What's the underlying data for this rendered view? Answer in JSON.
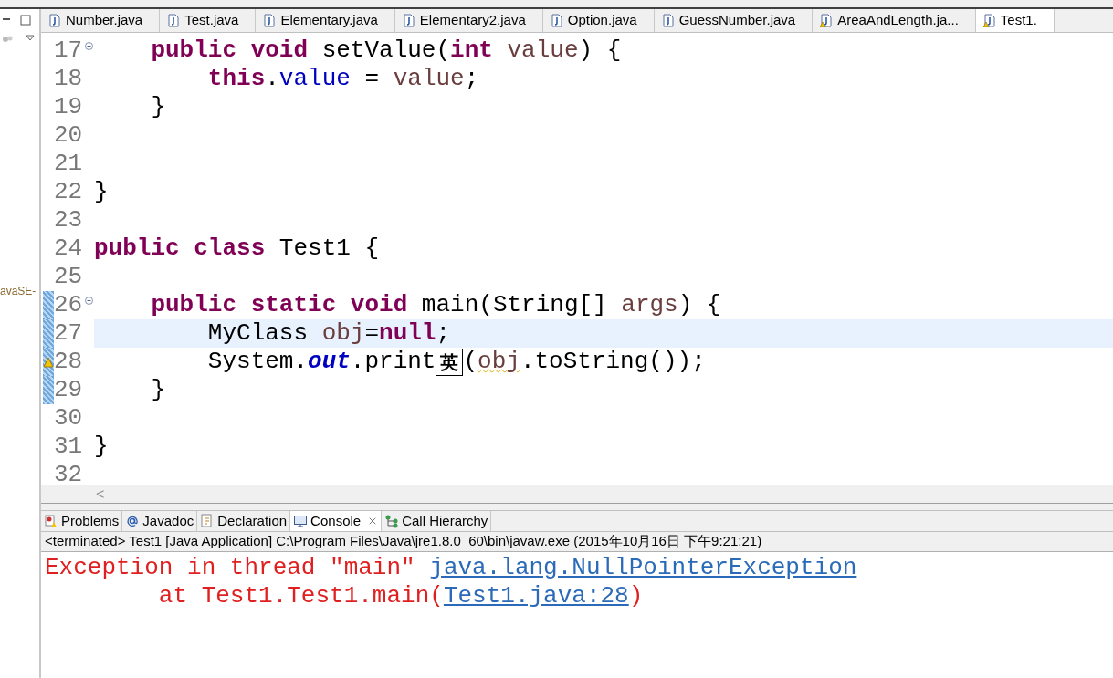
{
  "sidebar": {
    "label": "avaSE-"
  },
  "editor_tabs": [
    {
      "label": "Number.java",
      "kind": "java",
      "selected": false
    },
    {
      "label": "Test.java",
      "kind": "java",
      "selected": false
    },
    {
      "label": "Elementary.java",
      "kind": "java",
      "selected": false
    },
    {
      "label": "Elementary2.java",
      "kind": "java",
      "selected": false
    },
    {
      "label": "Option.java",
      "kind": "java",
      "selected": false
    },
    {
      "label": "GuessNumber.java",
      "kind": "java",
      "selected": false
    },
    {
      "label": "AreaAndLength.ja...",
      "kind": "java_warning",
      "selected": false
    },
    {
      "label": "Test1.",
      "kind": "java_warning",
      "selected": true
    }
  ],
  "code_lines": [
    {
      "number": "17",
      "fold": true,
      "current": false,
      "changed": false,
      "warning": false,
      "tokens": [
        {
          "text": "    public",
          "kind": "keyword"
        },
        {
          "text": " void",
          "kind": "keyword"
        },
        {
          "text": " setValue(",
          "kind": "plain"
        },
        {
          "text": "int",
          "kind": "keyword"
        },
        {
          "text": " value",
          "kind": "local"
        },
        {
          "text": ") {",
          "kind": "plain"
        }
      ]
    },
    {
      "number": "18",
      "fold": false,
      "current": false,
      "changed": false,
      "warning": false,
      "tokens": [
        {
          "text": "        this",
          "kind": "keyword"
        },
        {
          "text": ".",
          "kind": "plain"
        },
        {
          "text": "value",
          "kind": "field"
        },
        {
          "text": " = ",
          "kind": "plain"
        },
        {
          "text": "value",
          "kind": "local"
        },
        {
          "text": ";",
          "kind": "plain"
        }
      ]
    },
    {
      "number": "19",
      "fold": false,
      "current": false,
      "changed": false,
      "warning": false,
      "tokens": [
        {
          "text": "    }",
          "kind": "plain"
        }
      ]
    },
    {
      "number": "20",
      "fold": false,
      "current": false,
      "changed": false,
      "warning": false
    },
    {
      "number": "21",
      "fold": false,
      "current": false,
      "changed": false,
      "warning": false
    },
    {
      "number": "22",
      "fold": false,
      "current": false,
      "changed": false,
      "warning": false,
      "tokens": [
        {
          "text": "}",
          "kind": "plain"
        }
      ]
    },
    {
      "number": "23",
      "fold": false,
      "current": false,
      "changed": false,
      "warning": false
    },
    {
      "number": "24",
      "fold": false,
      "current": false,
      "changed": false,
      "warning": false,
      "tokens": [
        {
          "text": "public",
          "kind": "keyword"
        },
        {
          "text": " class",
          "kind": "keyword"
        },
        {
          "text": " Test1 {",
          "kind": "plain"
        }
      ]
    },
    {
      "number": "25",
      "fold": false,
      "current": false,
      "changed": false,
      "warning": false
    },
    {
      "number": "26",
      "fold": true,
      "current": false,
      "changed": true,
      "warning": false,
      "tokens": [
        {
          "text": "    public",
          "kind": "keyword"
        },
        {
          "text": " static",
          "kind": "keyword"
        },
        {
          "text": " void",
          "kind": "keyword"
        },
        {
          "text": " main(String[] ",
          "kind": "plain"
        },
        {
          "text": "args",
          "kind": "local"
        },
        {
          "text": ") {",
          "kind": "plain"
        }
      ]
    },
    {
      "number": "27",
      "fold": false,
      "current": true,
      "changed": true,
      "warning": false,
      "tokens": [
        {
          "text": "        MyClass ",
          "kind": "plain"
        },
        {
          "text": "obj",
          "kind": "local"
        },
        {
          "text": "=",
          "kind": "plain"
        },
        {
          "text": "null",
          "kind": "keyword"
        },
        {
          "text": ";",
          "kind": "plain"
        }
      ]
    },
    {
      "number": "28",
      "fold": false,
      "current": false,
      "changed": true,
      "warning": true,
      "tokens": [
        {
          "text": "        System.",
          "kind": "plain"
        },
        {
          "text": "out",
          "kind": "static_field"
        },
        {
          "text": ".print",
          "kind": "plain"
        },
        {
          "text": "英",
          "kind": "ime"
        },
        {
          "text": "(",
          "kind": "plain"
        },
        {
          "text": "obj",
          "kind": "local_warning"
        },
        {
          "text": ".toString());",
          "kind": "plain"
        }
      ]
    },
    {
      "number": "29",
      "fold": false,
      "current": false,
      "changed": true,
      "warning": false,
      "tokens": [
        {
          "text": "    }",
          "kind": "plain"
        }
      ]
    },
    {
      "number": "30",
      "fold": false,
      "current": false,
      "changed": false,
      "warning": false
    },
    {
      "number": "31",
      "fold": false,
      "current": false,
      "changed": false,
      "warning": false,
      "tokens": [
        {
          "text": "}",
          "kind": "plain"
        }
      ]
    },
    {
      "number": "32",
      "fold": false,
      "current": false,
      "changed": false,
      "warning": false
    }
  ],
  "scrollbar": {
    "arrow": "<"
  },
  "panel_tabs": [
    {
      "label": "Problems",
      "kind": "problems",
      "selected": false
    },
    {
      "label": "Javadoc",
      "kind": "javadoc",
      "selected": false
    },
    {
      "label": "Declaration",
      "kind": "declaration",
      "selected": false
    },
    {
      "label": "Console",
      "kind": "console",
      "selected": true
    },
    {
      "label": "Call Hierarchy",
      "kind": "hierarchy",
      "selected": false
    }
  ],
  "console": {
    "header": "<terminated> Test1 [Java Application] C:\\Program Files\\Java\\jre1.8.0_60\\bin\\javaw.exe (2015年10月16日 下午9:21:21)",
    "lines": [
      [
        {
          "text": "Exception in thread \"main\" ",
          "kind": "error"
        },
        {
          "text": "java.lang.NullPointerException",
          "kind": "link"
        }
      ],
      [
        {
          "text": "        at Test1.Test1.main(",
          "kind": "error"
        },
        {
          "text": "Test1.java:28",
          "kind": "link"
        },
        {
          "text": ")",
          "kind": "error"
        }
      ]
    ]
  }
}
